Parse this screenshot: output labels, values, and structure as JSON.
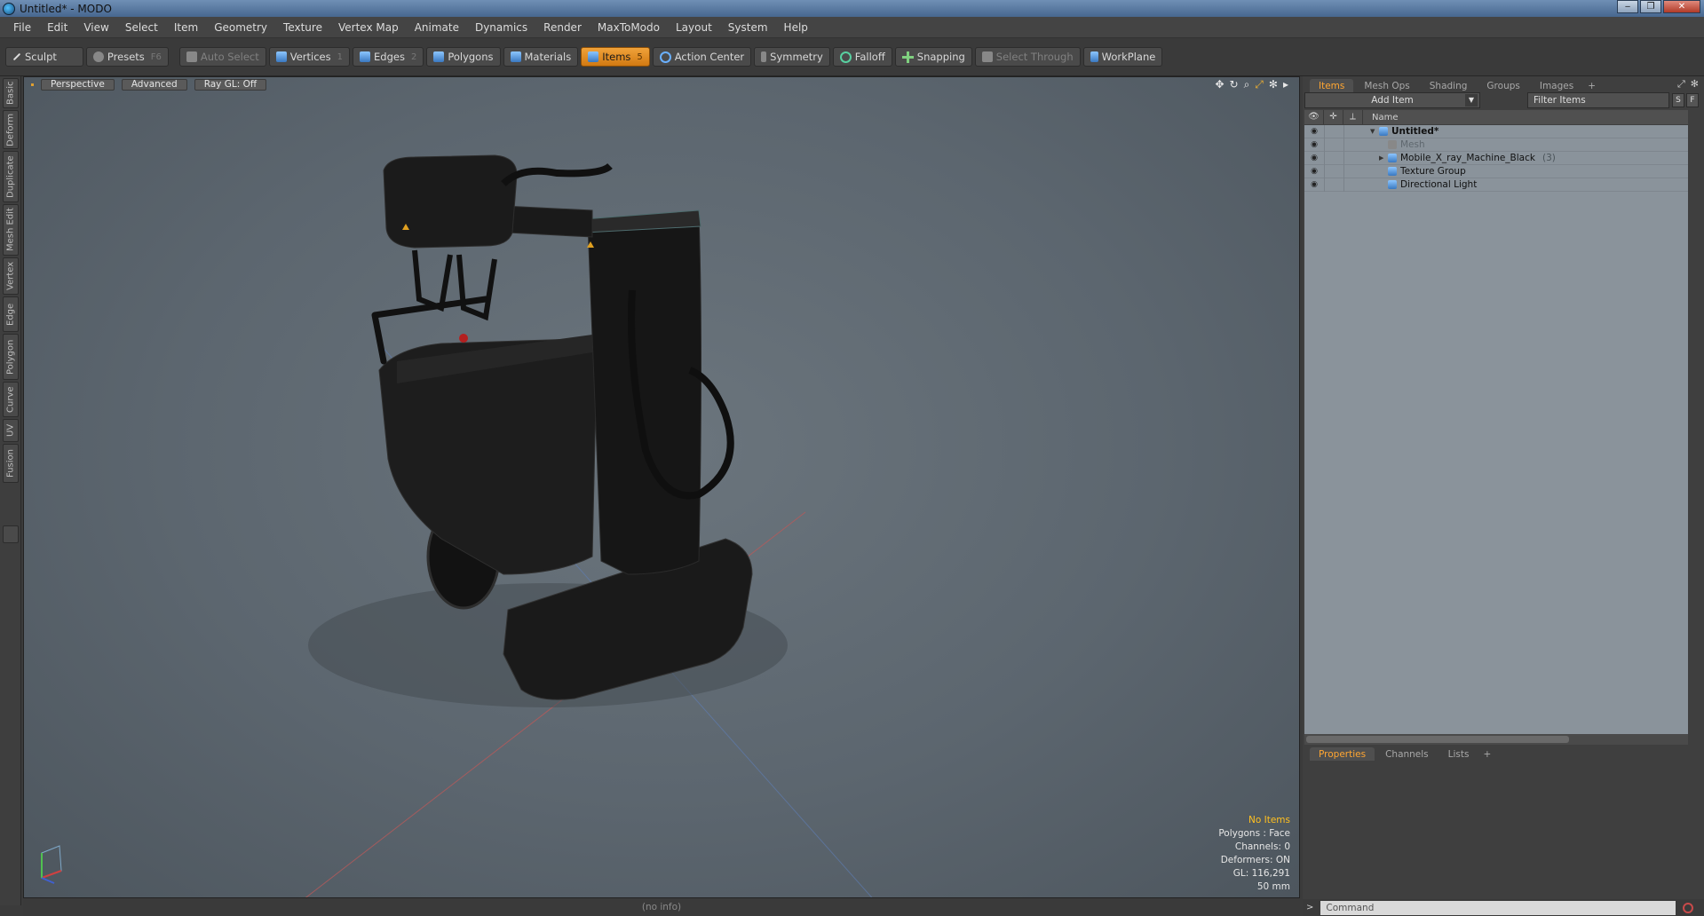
{
  "window": {
    "title": "Untitled* - MODO"
  },
  "menubar": [
    "File",
    "Edit",
    "View",
    "Select",
    "Item",
    "Geometry",
    "Texture",
    "Vertex Map",
    "Animate",
    "Dynamics",
    "Render",
    "MaxToModo",
    "Layout",
    "System",
    "Help"
  ],
  "toolbar": {
    "sculpt": "Sculpt",
    "presets": "Presets",
    "presets_key": "F6",
    "auto_select": "Auto Select",
    "vertices": "Vertices",
    "vertices_key": "1",
    "edges": "Edges",
    "edges_key": "2",
    "polygons": "Polygons",
    "materials": "Materials",
    "items": "Items",
    "items_key": "5",
    "action_center": "Action Center",
    "symmetry": "Symmetry",
    "falloff": "Falloff",
    "snapping": "Snapping",
    "select_through": "Select Through",
    "workplane": "WorkPlane"
  },
  "left_tabs": [
    "Basic",
    "Deform",
    "Duplicate",
    "Mesh Edit",
    "Vertex",
    "Edge",
    "Polygon",
    "Curve",
    "UV",
    "Fusion"
  ],
  "viewport": {
    "perspective": "Perspective",
    "advanced": "Advanced",
    "raygl": "Ray GL: Off",
    "stats": {
      "no_items": "No Items",
      "polygons": "Polygons : Face",
      "channels": "Channels: 0",
      "deformers": "Deformers: ON",
      "gl": "GL: 116,291",
      "unit": "50 mm"
    },
    "status": "(no info)"
  },
  "right_panel": {
    "tabs": [
      "Items",
      "Mesh Ops",
      "Shading",
      "Groups",
      "Images"
    ],
    "add_item": "Add Item",
    "filter_placeholder": "Filter Items",
    "filter_s": "S",
    "filter_f": "F",
    "column_name": "Name",
    "tree": [
      {
        "name": "Untitled*",
        "level": 0,
        "bold": true,
        "expander": "▼"
      },
      {
        "name": "Mesh",
        "level": 1,
        "dim": true,
        "expander": ""
      },
      {
        "name": "Mobile_X_ray_Machine_Black",
        "count": "(3)",
        "level": 1,
        "expander": "▶"
      },
      {
        "name": "Texture Group",
        "level": 1,
        "expander": ""
      },
      {
        "name": "Directional Light",
        "level": 1,
        "expander": ""
      }
    ],
    "bottom_tabs": [
      "Properties",
      "Channels",
      "Lists"
    ],
    "command_placeholder": "Command"
  },
  "colors": {
    "accent_orange": "#f0a23a",
    "viewport_bg": "#5f6972",
    "tree_bg": "#8a939b"
  }
}
